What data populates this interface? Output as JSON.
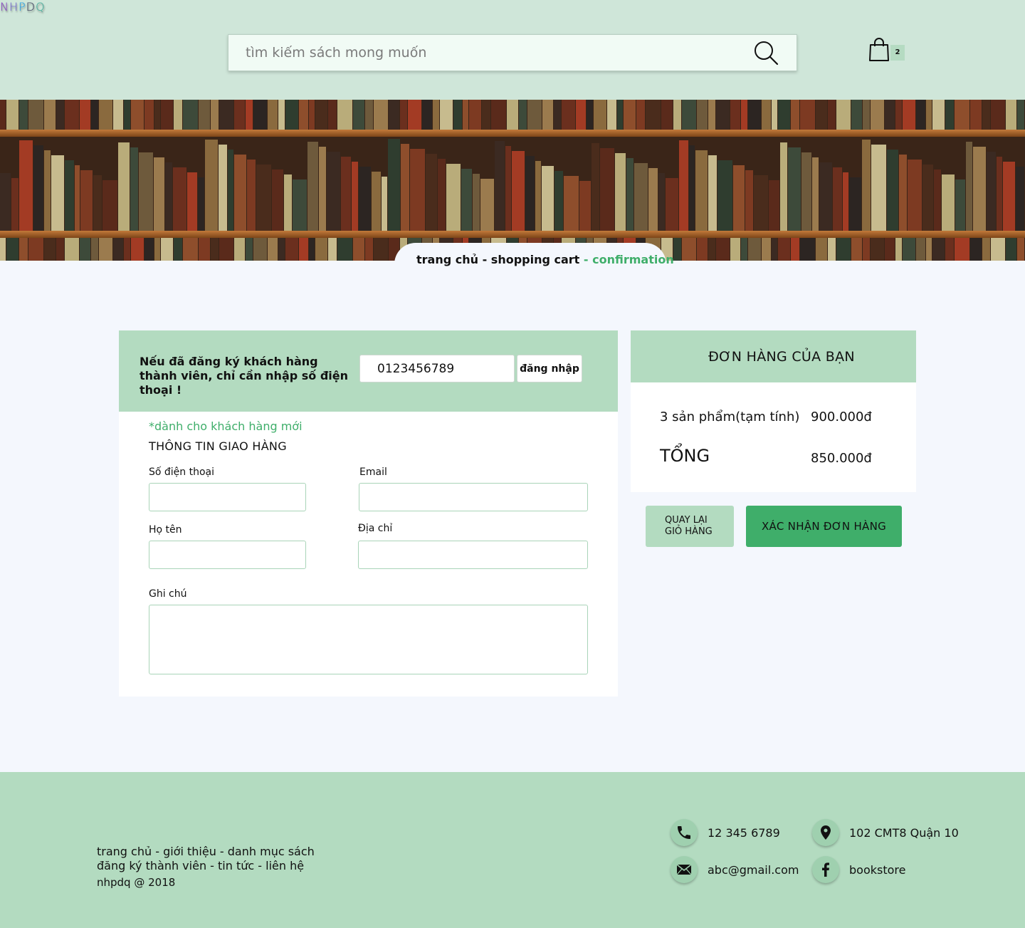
{
  "brand": {
    "logo_letters": [
      "N",
      "H",
      "P",
      "D",
      "Q"
    ]
  },
  "header": {
    "search_placeholder": "tìm kiếm sách mong muốn",
    "cart_count": "2"
  },
  "banner": {
    "shelf_colors": [
      "#5a2a1b",
      "#7d3a22",
      "#2f3d2f",
      "#8a6a3e",
      "#a33b24",
      "#3b2a22",
      "#6e5a3c",
      "#b9ac7a",
      "#4a2c1c",
      "#8e4e2c",
      "#c7bb8e",
      "#2c2522",
      "#6b2f1e",
      "#9b7b4e",
      "#3d4a3a"
    ]
  },
  "breadcrumb": {
    "home": "trang chủ",
    "cart": "shopping cart",
    "current": "confirmation",
    "sep": " - "
  },
  "login": {
    "text": "Nếu đã đăng ký khách hàng thành viên, chỉ cần nhập số điện thoại !",
    "phone_value": "0123456789",
    "button": "đăng nhập"
  },
  "shipping": {
    "new_customer_note": "*dành cho khách hàng mới",
    "title": "THÔNG TIN GIAO HÀNG",
    "labels": {
      "phone": "Số điện thoại",
      "email": "Email",
      "name": "Họ tên",
      "address": "Địa chỉ",
      "note": "Ghi chú"
    }
  },
  "order": {
    "title": "ĐƠN HÀNG CỦA BẠN",
    "subtotal_label": "3 sản phẩm(tạm tính)",
    "subtotal_value": "900.000đ",
    "total_label": "TỔNG",
    "total_value": "850.000đ",
    "back_button_line1": "QUAY LẠI",
    "back_button_line2": "GIỎ HÀNG",
    "confirm_button": "XÁC NHẬN ĐƠN HÀNG"
  },
  "footer": {
    "links_line1": "trang chủ - giới thiệu - danh mục sách",
    "links_line2": "đăng ký thành viên - tin tức -  liên hệ",
    "copyright": "nhpdq @ 2018",
    "phone": "12 345 6789",
    "address": "102 CMT8 Quận 10",
    "email": "abc@gmail.com",
    "facebook": "bookstore"
  },
  "colors": {
    "header_bg": "#cfe6d9",
    "panel_green": "#b3dbc0",
    "accent_green": "#3fae6a",
    "page_bg": "#f4f7fd"
  },
  "icons": {
    "search": "search-icon",
    "cart": "shopping-bag-icon",
    "phone": "phone-icon",
    "location": "location-pin-icon",
    "email": "envelope-icon",
    "facebook": "facebook-icon"
  }
}
